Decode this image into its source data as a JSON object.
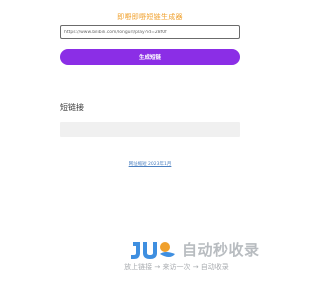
{
  "header": {
    "title": "即嘢即嘢短链生成器"
  },
  "form": {
    "url_value": "https://www.bilibili.com/longurl/play?id=28f0f",
    "generate_label": "生成短链"
  },
  "result": {
    "label": "短链接",
    "value": ""
  },
  "footer": {
    "link_text": "网址缩短 2023年1月"
  },
  "watermark": {
    "brand_text": "自动秒收录",
    "slogan": "放上链接 → 来访一次 → 自动收录",
    "colors": {
      "blue": "#3f8fe0",
      "orange": "#f0a02c",
      "gray": "#b8bcc0"
    }
  },
  "colors": {
    "accent": "#8b2ee6",
    "title": "#f0a02c",
    "link": "#4a7fc0",
    "result_bg": "#f0f0f0"
  }
}
